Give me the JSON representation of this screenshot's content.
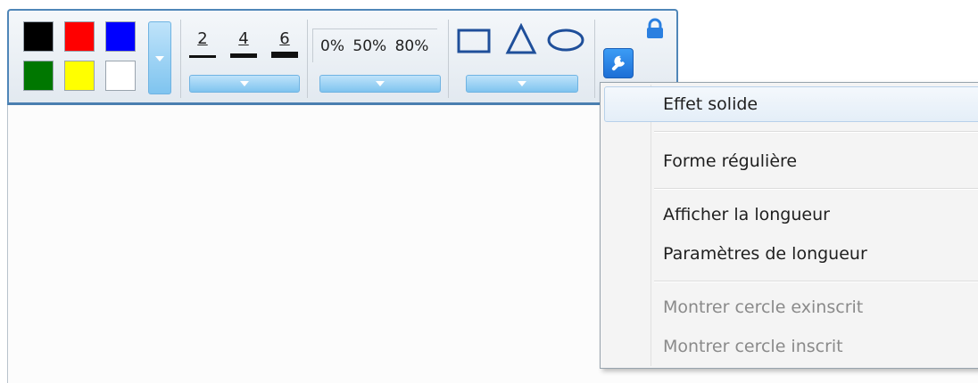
{
  "toolbar": {
    "colors": [
      "#000000",
      "#ff0000",
      "#0000ff",
      "#007700",
      "#ffff00",
      "#ffffff"
    ],
    "line_widths": [
      "2",
      "4",
      "6"
    ],
    "opacity_options": [
      "0%",
      "50%",
      "80%"
    ],
    "shapes": [
      "rectangle-shape",
      "triangle-shape",
      "ellipse-shape"
    ],
    "accent": "#1d6fd6"
  },
  "context_menu": {
    "items": [
      {
        "label": "Effet solide",
        "state": "highlighted"
      },
      {
        "label": "Forme régulière",
        "state": "normal"
      },
      {
        "label": "Afficher la longueur",
        "state": "normal"
      },
      {
        "label": "Paramètres de longueur",
        "state": "normal"
      },
      {
        "label": "Montrer cercle exinscrit",
        "state": "disabled"
      },
      {
        "label": "Montrer cercle inscrit",
        "state": "disabled"
      }
    ]
  }
}
